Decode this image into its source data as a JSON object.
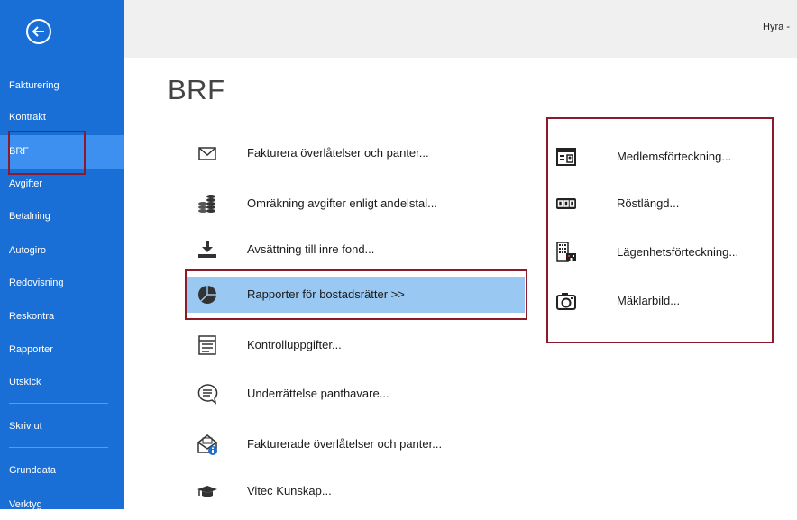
{
  "topbar": {
    "text": "Hyra -"
  },
  "page": {
    "title": "BRF"
  },
  "sidebar": {
    "items": [
      {
        "label": "Fakturering"
      },
      {
        "label": "Kontrakt"
      },
      {
        "label": "BRF",
        "active": true
      },
      {
        "label": "Avgifter"
      },
      {
        "label": "Betalning"
      },
      {
        "label": "Autogiro"
      },
      {
        "label": "Redovisning"
      },
      {
        "label": "Reskontra"
      },
      {
        "label": "Rapporter"
      },
      {
        "label": "Utskick"
      },
      {
        "label": "Skriv ut"
      },
      {
        "label": "Grunddata"
      },
      {
        "label": "Verktyg"
      }
    ]
  },
  "menu": {
    "items": [
      {
        "label": "Fakturera överlåtelser och panter...",
        "icon": "envelope-icon"
      },
      {
        "label": "Omräkning avgifter enligt andelstal...",
        "icon": "coins-icon"
      },
      {
        "label": "Avsättning till inre fond...",
        "icon": "download-tray-icon"
      },
      {
        "label": "Rapporter för bostadsrätter >>",
        "icon": "pie-chart-icon",
        "active": true
      },
      {
        "label": "Kontrolluppgifter...",
        "icon": "form-icon"
      },
      {
        "label": "Underrättelse panthavare...",
        "icon": "speech-bubble-icon"
      },
      {
        "label": "Fakturerade överlåtelser och panter...",
        "icon": "envelope-info-icon"
      },
      {
        "label": "Vitec Kunskap...",
        "icon": "graduation-cap-icon"
      }
    ]
  },
  "submenu": {
    "items": [
      {
        "label": "Medlemsförteckning...",
        "icon": "id-card-icon"
      },
      {
        "label": "Röstlängd...",
        "icon": "counter-icon"
      },
      {
        "label": "Lägenhetsförteckning...",
        "icon": "building-icon"
      },
      {
        "label": "Mäklarbild...",
        "icon": "camera-icon"
      }
    ]
  },
  "colors": {
    "sidebar": "#1a6fd6",
    "active_nav": "#3d8ff0",
    "active_menu": "#99c8f2",
    "highlight_border": "#8b1a2b"
  }
}
